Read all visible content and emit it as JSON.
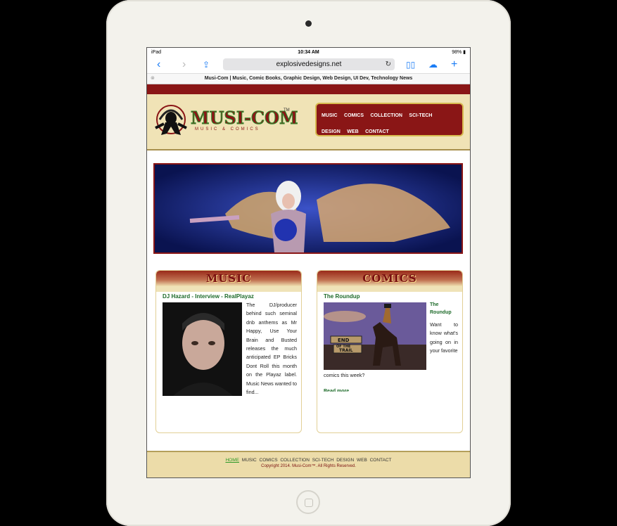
{
  "status": {
    "device": "iPad",
    "time": "10:34 AM",
    "battery": "98%"
  },
  "browser": {
    "url": "explosivedesigns.net",
    "tab_title": "Musi-Com | Music, Comic Books, Graphic Design, Web Design, UI Dev, Technology News",
    "icons": [
      "back-icon",
      "forward-icon",
      "share-icon",
      "bookmarks-icon",
      "cloud-icon",
      "add-tab-icon",
      "reload-icon"
    ]
  },
  "site": {
    "logo_text": "MUSI-COM",
    "logo_sub": "MUSIC & COMICS",
    "logo_tm": "TM",
    "nav": [
      "MUSIC",
      "COMICS",
      "COLLECTION",
      "SCI-TECH",
      "DESIGN",
      "WEB",
      "CONTACT"
    ],
    "colors": {
      "brand_red": "#8a1616",
      "cream": "#f0e3b6",
      "gold": "#d7b94e",
      "green": "#1e6b2a"
    }
  },
  "music": {
    "heading": "MUSIC",
    "article_title": "DJ Hazard - Interview - RealPlayaz",
    "excerpt": "The DJ/producer behind such seminal dnb anthems as Mr Happy, Use Your Brain and Busted releases the much anticipated EP Bricks Dont Roll this month on the Playaz label. Music News wanted to find..."
  },
  "comics": {
    "heading": "COMICS",
    "article_title": "The Roundup",
    "side_title": "The Roundup",
    "excerpt_side": "Want to know what's going on in your favorite",
    "excerpt_rest": "comics this week?",
    "read_more": "Read more",
    "sign_line1": "END",
    "sign_line2": "OF THE",
    "sign_line3": "TRAIL"
  },
  "footer": {
    "links": [
      "HOME",
      "MUSIC",
      "COMICS",
      "COLLECTION",
      "SCI-TECH",
      "DESIGN",
      "WEB",
      "CONTACT"
    ],
    "copyright": "Copyright 2014. Musi-Com™. All Rights Reserved."
  }
}
